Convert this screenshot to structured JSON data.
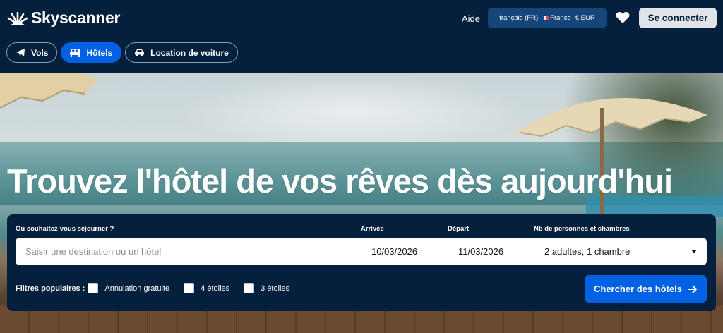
{
  "header": {
    "brand": "Skyscanner",
    "help": "Aide",
    "locale": {
      "language": "français (FR)",
      "country": "France",
      "currency": "€ EUR"
    },
    "login": "Se connecter"
  },
  "tabs": [
    {
      "label": "Vols",
      "icon": "plane-icon",
      "active": false
    },
    {
      "label": "Hôtels",
      "icon": "bed-icon",
      "active": true
    },
    {
      "label": "Location de voiture",
      "icon": "car-icon",
      "active": false
    }
  ],
  "hero": {
    "headline": "Trouvez l'hôtel de vos rêves dès aujourd'hui"
  },
  "search": {
    "destination_label": "Où souhaitez-vous séjourner ?",
    "destination_placeholder": "Saisir une destination ou un hôtel",
    "checkin_label": "Arrivée",
    "checkin_value": "10/03/2026",
    "checkout_label": "Départ",
    "checkout_value": "11/03/2026",
    "guests_label": "Nb de personnes et chambres",
    "guests_value": "2 adultes, 1 chambre",
    "filters_title": "Filtres populaires :",
    "filters": [
      {
        "label": "Annulation gratuite",
        "checked": false
      },
      {
        "label": "4 étoiles",
        "checked": false
      },
      {
        "label": "3 étoiles",
        "checked": false
      }
    ],
    "submit": "Chercher des hôtels"
  },
  "colors": {
    "navy": "#05203c",
    "accent": "#0062e3",
    "locale_bg": "#154679",
    "login_bg": "#e0e4e9"
  }
}
